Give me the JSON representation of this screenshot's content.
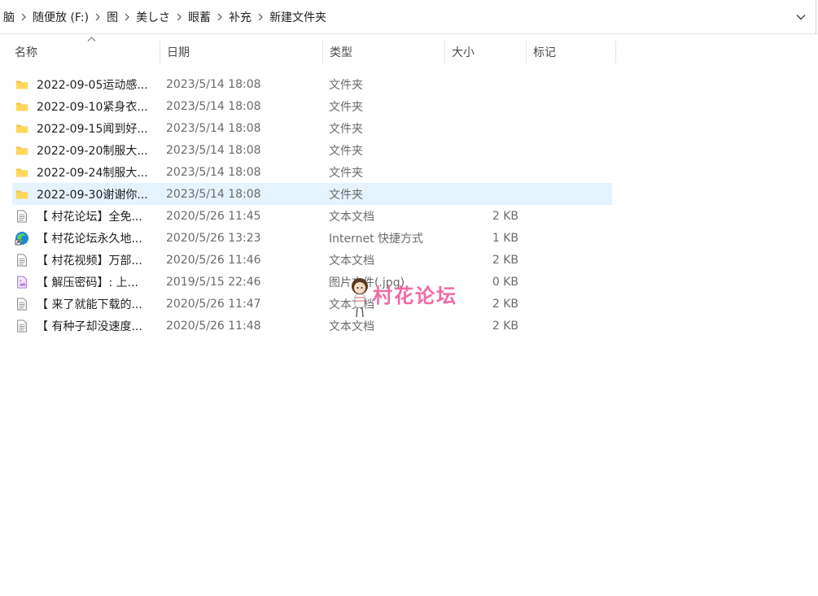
{
  "breadcrumb": {
    "items": [
      "脑",
      "随便放 (F:)",
      "图",
      "美しさ",
      "眼蓄",
      "补充",
      "新建文件夹"
    ]
  },
  "columns": {
    "name": "名称",
    "date": "日期",
    "type": "类型",
    "size": "大小",
    "tags": "标记"
  },
  "files": [
    {
      "name": "2022-09-05运动感...",
      "date": "2023/5/14 18:08",
      "type": "文件夹",
      "size": "",
      "icon": "folder-icon"
    },
    {
      "name": "2022-09-10紧身衣...",
      "date": "2023/5/14 18:08",
      "type": "文件夹",
      "size": "",
      "icon": "folder-icon"
    },
    {
      "name": "2022-09-15闻到好...",
      "date": "2023/5/14 18:08",
      "type": "文件夹",
      "size": "",
      "icon": "folder-icon"
    },
    {
      "name": "2022-09-20制服大...",
      "date": "2023/5/14 18:08",
      "type": "文件夹",
      "size": "",
      "icon": "folder-icon"
    },
    {
      "name": "2022-09-24制服大...",
      "date": "2023/5/14 18:08",
      "type": "文件夹",
      "size": "",
      "icon": "folder-icon"
    },
    {
      "name": "2022-09-30谢谢你...",
      "date": "2023/5/14 18:08",
      "type": "文件夹",
      "size": "",
      "icon": "folder-icon"
    },
    {
      "name": "【 村花论坛】全免...",
      "date": "2020/5/26 11:45",
      "type": "文本文档",
      "size": "2 KB",
      "icon": "text-document-icon"
    },
    {
      "name": "【 村花论坛永久地...",
      "date": "2020/5/26 13:23",
      "type": "Internet 快捷方式",
      "size": "1 KB",
      "icon": "edge-shortcut-icon"
    },
    {
      "name": "【 村花视频】万部...",
      "date": "2020/5/26 11:46",
      "type": "文本文档",
      "size": "2 KB",
      "icon": "text-document-icon"
    },
    {
      "name": "【 解压密码】: 上...",
      "date": "2019/5/15 22:46",
      "type": "图片文件(.jpg)",
      "size": "0 KB",
      "icon": "image-file-icon"
    },
    {
      "name": "【 来了就能下载的...",
      "date": "2020/5/26 11:47",
      "type": "文本文档",
      "size": "2 KB",
      "icon": "text-document-icon"
    },
    {
      "name": "【 有种子却没速度...",
      "date": "2020/5/26 11:48",
      "type": "文本文档",
      "size": "2 KB",
      "icon": "text-document-icon"
    }
  ],
  "selected_index": 5,
  "watermark": {
    "text": "村花论坛",
    "color": "#f26aa6"
  }
}
